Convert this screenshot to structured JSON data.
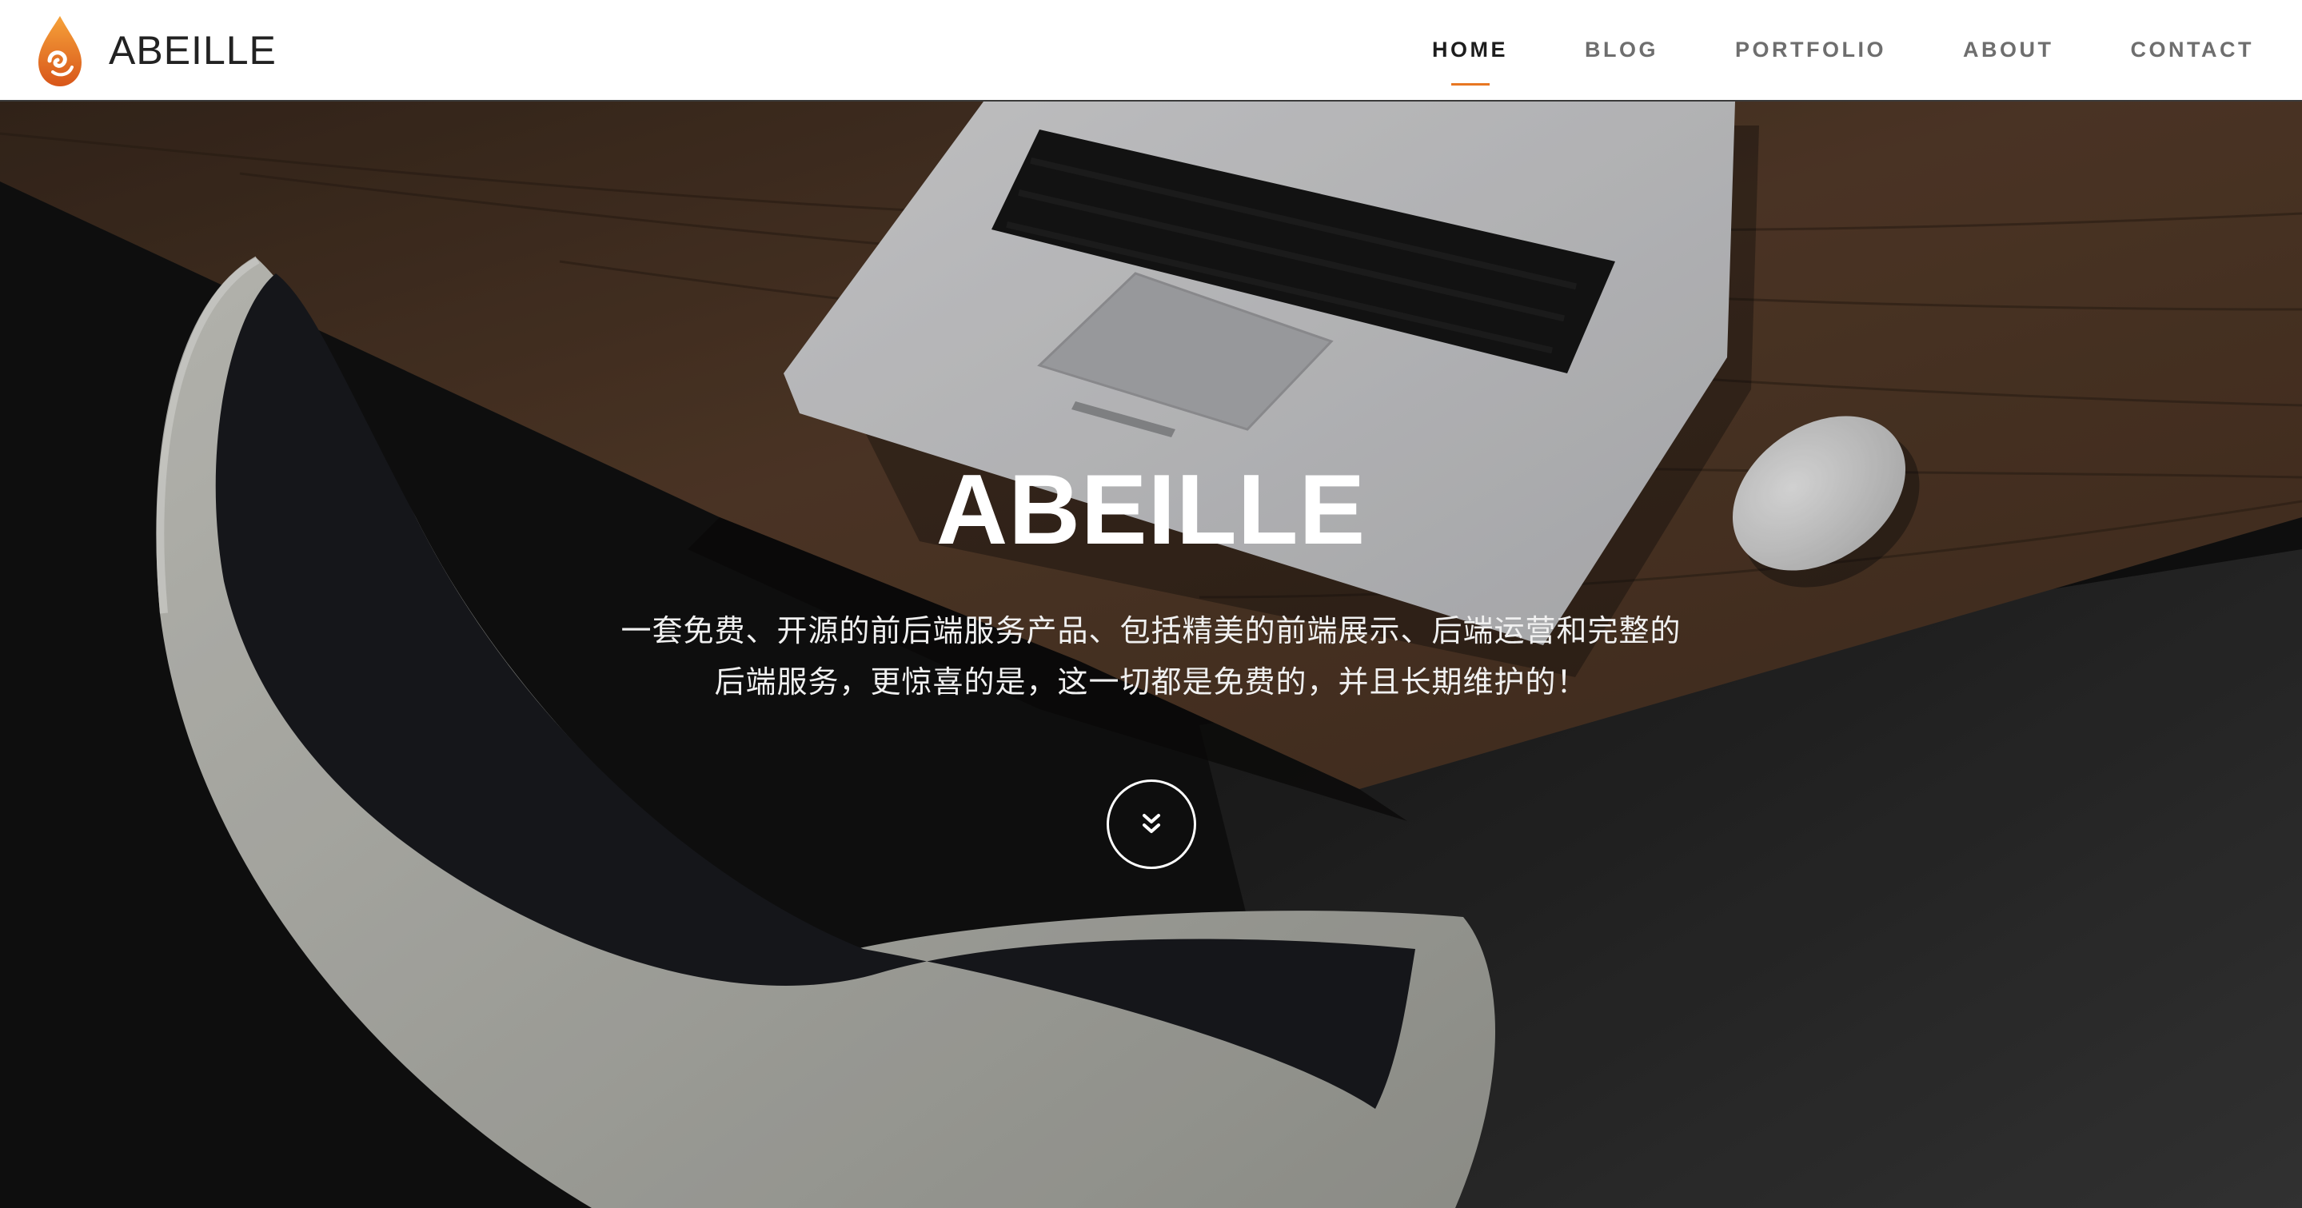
{
  "brand": {
    "name": "ABEILLE",
    "logo_icon": "bee-drop-logo-icon",
    "accent_color": "#e87722"
  },
  "nav": {
    "items": [
      {
        "label": "HOME",
        "active": true
      },
      {
        "label": "BLOG",
        "active": false
      },
      {
        "label": "PORTFOLIO",
        "active": false
      },
      {
        "label": "ABOUT",
        "active": false
      },
      {
        "label": "CONTACT",
        "active": false
      }
    ]
  },
  "hero": {
    "title": "ABEILLE",
    "description_line1": "一套免费、开源的前后端服务产品、包括精美的前端展示、后端运营和完整的",
    "description_line2": "后端服务，更惊喜的是，这一切都是免费的，并且长期维护的！",
    "scroll_icon": "chevron-double-down-icon",
    "background": "desk-with-laptop-mouse-and-white-chair-photo"
  }
}
